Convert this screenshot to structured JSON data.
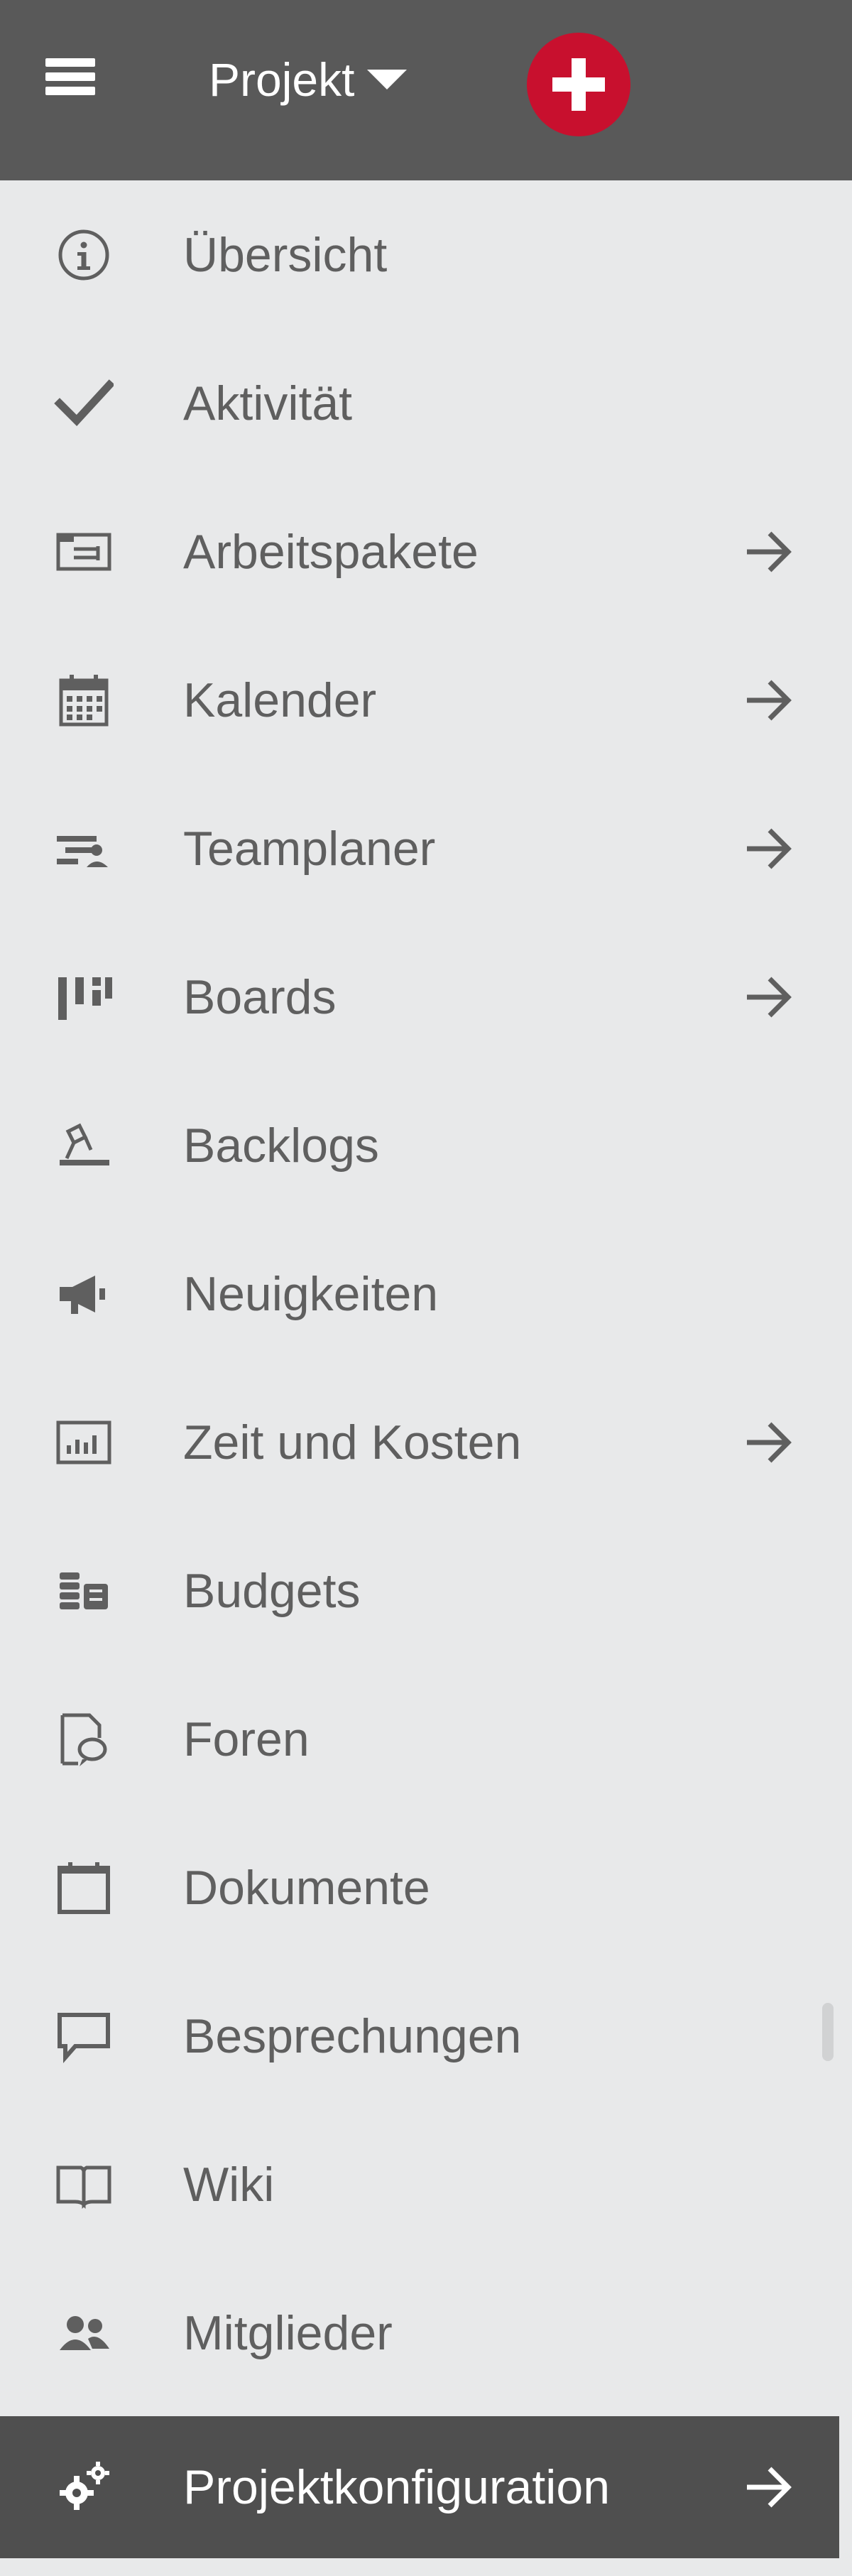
{
  "header": {
    "project_label": "Projekt",
    "menu_icon": "hamburger-menu-icon",
    "caret_icon": "caret-down-icon",
    "add_icon": "plus-icon"
  },
  "menu": {
    "items": [
      {
        "label": "Übersicht",
        "icon": "info-icon",
        "has_arrow": false
      },
      {
        "label": "Aktivität",
        "icon": "checkmark-icon",
        "has_arrow": false
      },
      {
        "label": "Arbeitspakete",
        "icon": "work-packages-icon",
        "has_arrow": true
      },
      {
        "label": "Kalender",
        "icon": "calendar-icon",
        "has_arrow": true
      },
      {
        "label": "Teamplaner",
        "icon": "team-planner-icon",
        "has_arrow": true
      },
      {
        "label": "Boards",
        "icon": "boards-icon",
        "has_arrow": true
      },
      {
        "label": "Backlogs",
        "icon": "backlogs-icon",
        "has_arrow": false
      },
      {
        "label": "Neuigkeiten",
        "icon": "megaphone-icon",
        "has_arrow": false
      },
      {
        "label": "Zeit und Kosten",
        "icon": "time-costs-icon",
        "has_arrow": true
      },
      {
        "label": "Budgets",
        "icon": "budget-icon",
        "has_arrow": false
      },
      {
        "label": "Foren",
        "icon": "forum-icon",
        "has_arrow": false
      },
      {
        "label": "Dokumente",
        "icon": "documents-icon",
        "has_arrow": false
      },
      {
        "label": "Besprechungen",
        "icon": "meetings-icon",
        "has_arrow": false
      },
      {
        "label": "Wiki",
        "icon": "wiki-book-icon",
        "has_arrow": false
      },
      {
        "label": "Mitglieder",
        "icon": "members-icon",
        "has_arrow": false
      },
      {
        "label": "Projektkonfiguration",
        "icon": "settings-gears-icon",
        "has_arrow": true,
        "active": true
      }
    ],
    "arrow_icon": "arrow-right-icon"
  },
  "colors": {
    "header_bg": "#595959",
    "menu_bg": "#e8e9ea",
    "accent_red": "#c8102e",
    "active_bg": "#4f4f4f",
    "text": "#5f5f5f",
    "active_text": "#ffffff"
  }
}
